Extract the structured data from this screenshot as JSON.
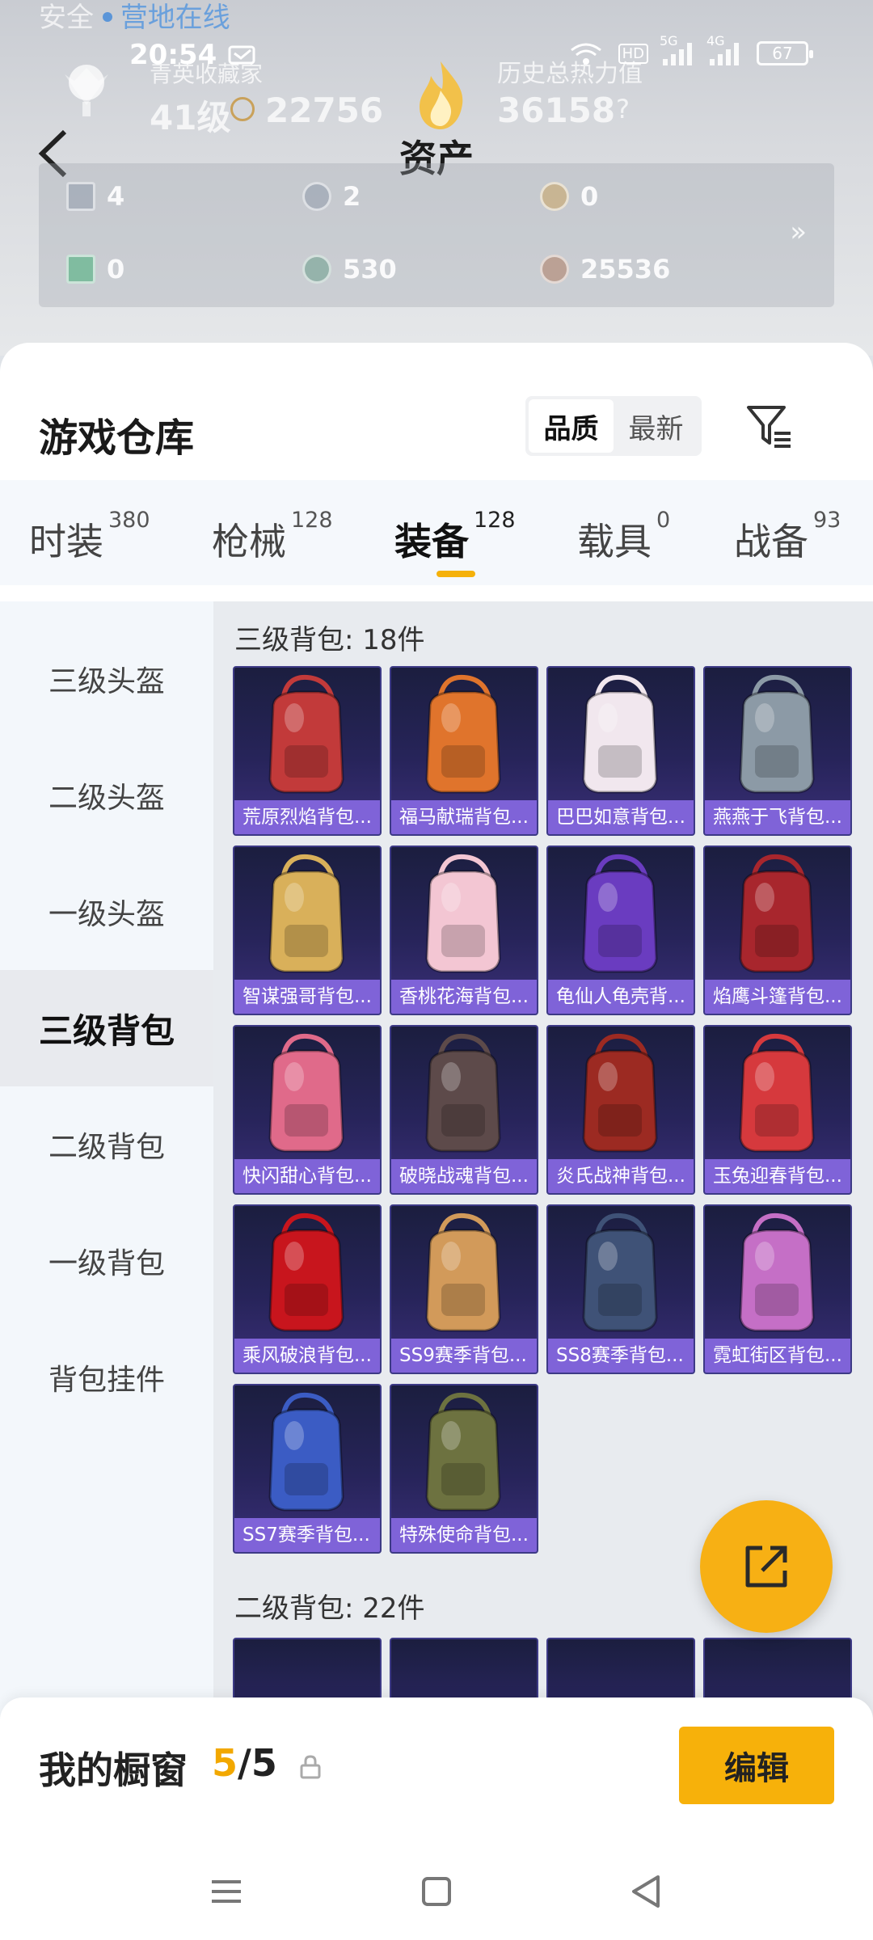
{
  "hero": {
    "online_name": "安全 ",
    "online_status": "营地在线",
    "collection_label": "青英收藏家",
    "collection_level": "41级",
    "collection_score": "22756",
    "history_label": "历史总热力值",
    "history_value": "36158",
    "help_mark": "?"
  },
  "status_bar": {
    "time": "20:54",
    "network_labels": [
      "HD",
      "5G",
      "4G"
    ],
    "battery": "67"
  },
  "header": {
    "title": "资产"
  },
  "assets": [
    {
      "value": "4",
      "color": "#9aa6b8"
    },
    {
      "value": "2",
      "color": "#9aa6b8"
    },
    {
      "value": "0",
      "color": "#c9a66b"
    },
    {
      "value": "0",
      "color": "#4fb07f"
    },
    {
      "value": "530",
      "color": "#7fa89a"
    },
    {
      "value": "25536",
      "color": "#b58f7a"
    }
  ],
  "assets_more": "»",
  "warehouse": {
    "title": "游戏仓库",
    "sort_options": [
      "品质",
      "最新"
    ],
    "sort_active": 0
  },
  "categories": [
    {
      "label": "时装",
      "count": "380"
    },
    {
      "label": "枪械",
      "count": "128"
    },
    {
      "label": "装备",
      "count": "128"
    },
    {
      "label": "载具",
      "count": "0"
    },
    {
      "label": "战备",
      "count": "93"
    }
  ],
  "category_active": 2,
  "sidebar": [
    "三级头盔",
    "二级头盔",
    "一级头盔",
    "三级背包",
    "二级背包",
    "一级背包",
    "背包挂件"
  ],
  "sidebar_active": 3,
  "sections": [
    {
      "title": "三级背包: 18件",
      "items": [
        {
          "name": "荒原烈焰背包...",
          "color": "#c23a3a"
        },
        {
          "name": "福马献瑞背包...",
          "color": "#e0742c"
        },
        {
          "name": "巴巴如意背包...",
          "color": "#f1e7ee"
        },
        {
          "name": "燕燕于飞背包...",
          "color": "#8c9aa6"
        },
        {
          "name": "智谋强哥背包...",
          "color": "#d9b05a"
        },
        {
          "name": "香桃花海背包...",
          "color": "#f3c6d3"
        },
        {
          "name": "龟仙人龟壳背...",
          "color": "#6a3cc0"
        },
        {
          "name": "焰鹰斗篷背包...",
          "color": "#a8262d"
        },
        {
          "name": "快闪甜心背包...",
          "color": "#e06a8a"
        },
        {
          "name": "破晓战魂背包...",
          "color": "#5d4a4a"
        },
        {
          "name": "炎氏战神背包...",
          "color": "#9c2a22"
        },
        {
          "name": "玉兔迎春背包...",
          "color": "#d6393d"
        },
        {
          "name": "乘风破浪背包...",
          "color": "#c8151d"
        },
        {
          "name": "SS9赛季背包...",
          "color": "#d29a5a"
        },
        {
          "name": "SS8赛季背包...",
          "color": "#3f5277"
        },
        {
          "name": "霓虹街区背包...",
          "color": "#c56fc6"
        },
        {
          "name": "SS7赛季背包...",
          "color": "#3b5cc4"
        },
        {
          "name": "特殊使命背包...",
          "color": "#6d7240"
        }
      ]
    },
    {
      "title": "二级背包: 22件",
      "items": []
    }
  ],
  "fab_icon": "share-export-icon",
  "window_bar": {
    "label": "我的橱窗",
    "current": "5",
    "separator": "/",
    "total": "5",
    "edit_label": "编辑"
  }
}
